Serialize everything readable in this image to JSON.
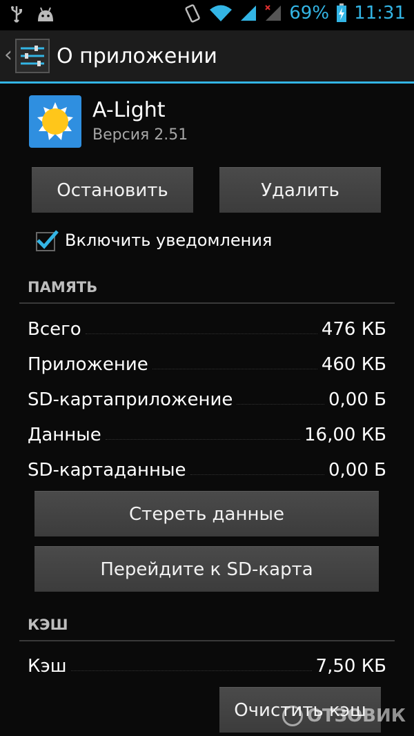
{
  "status_bar": {
    "battery_percent": "69%",
    "time": "11:31",
    "icons": [
      "usb-icon",
      "android-icon",
      "vibrate-icon",
      "wifi-icon",
      "signal-icon",
      "signal-no-data-icon",
      "battery-charging-icon"
    ]
  },
  "action_bar": {
    "title": "О приложении"
  },
  "app": {
    "name": "A-Light",
    "version": "Версия 2.51"
  },
  "buttons": {
    "stop": "Остановить",
    "uninstall": "Удалить",
    "clear_data": "Стереть данные",
    "move_to_sd": "Перейдите к SD-карта",
    "clear_cache": "Очистить кэш"
  },
  "notifications": {
    "label": "Включить уведомления",
    "checked": true
  },
  "memory": {
    "title": "ПАМЯТЬ",
    "rows": [
      {
        "label": "Всего",
        "value": "476 КБ"
      },
      {
        "label": "Приложение",
        "value": "460 КБ"
      },
      {
        "label": "SD-картаприложение",
        "value": "0,00 Б"
      },
      {
        "label": "Данные",
        "value": "16,00 КБ"
      },
      {
        "label": "SD-картаданные",
        "value": "0,00 Б"
      }
    ]
  },
  "cache": {
    "title": "КЭШ",
    "rows": [
      {
        "label": "Кэш",
        "value": "7,50 КБ"
      }
    ]
  },
  "watermark": "ОТЗОВИК",
  "colors": {
    "accent": "#33b5e5",
    "button": "#444444",
    "background": "#0a0a0a"
  }
}
